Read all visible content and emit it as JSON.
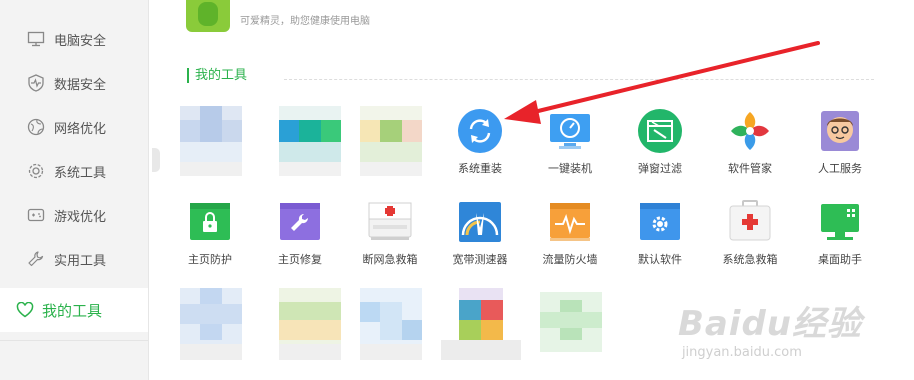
{
  "sidebar": {
    "items": [
      {
        "label": "电脑安全",
        "icon": "monitor-icon"
      },
      {
        "label": "数据安全",
        "icon": "shield-pulse-icon"
      },
      {
        "label": "网络优化",
        "icon": "globe-icon"
      },
      {
        "label": "系统工具",
        "icon": "gear-icon"
      },
      {
        "label": "游戏优化",
        "icon": "gamepad-icon"
      },
      {
        "label": "实用工具",
        "icon": "wrench-icon"
      },
      {
        "label": "我的工具",
        "icon": "heart-icon",
        "active": true
      }
    ]
  },
  "header": {
    "subtitle": "可爱精灵，助您健康使用电脑"
  },
  "section": {
    "title": "我的工具"
  },
  "tools_row1": [
    {
      "label": "系统重装",
      "icon": "refresh-circle-icon"
    },
    {
      "label": "一键装机",
      "icon": "speed-monitor-icon"
    },
    {
      "label": "弹窗过滤",
      "icon": "popup-filter-icon"
    },
    {
      "label": "软件管家",
      "icon": "app-manager-icon"
    },
    {
      "label": "人工服务",
      "icon": "support-person-icon"
    }
  ],
  "tools_row2": [
    {
      "label": "主页防护",
      "icon": "lock-icon"
    },
    {
      "label": "主页修复",
      "icon": "repair-wrench-icon"
    },
    {
      "label": "断网急救箱",
      "icon": "first-aid-kit-icon"
    },
    {
      "label": "宽带测速器",
      "icon": "speedometer-icon"
    },
    {
      "label": "流量防火墙",
      "icon": "firewall-icon"
    },
    {
      "label": "默认软件",
      "icon": "settings-window-icon"
    },
    {
      "label": "系统急救箱",
      "icon": "system-aid-kit-icon"
    },
    {
      "label": "桌面助手",
      "icon": "desktop-assistant-icon"
    }
  ],
  "watermark": {
    "logo": "Baidu经验",
    "url": "jingyan.baidu.com"
  },
  "colors": {
    "accent": "#2bb24c",
    "arrow": "#e8232a"
  }
}
